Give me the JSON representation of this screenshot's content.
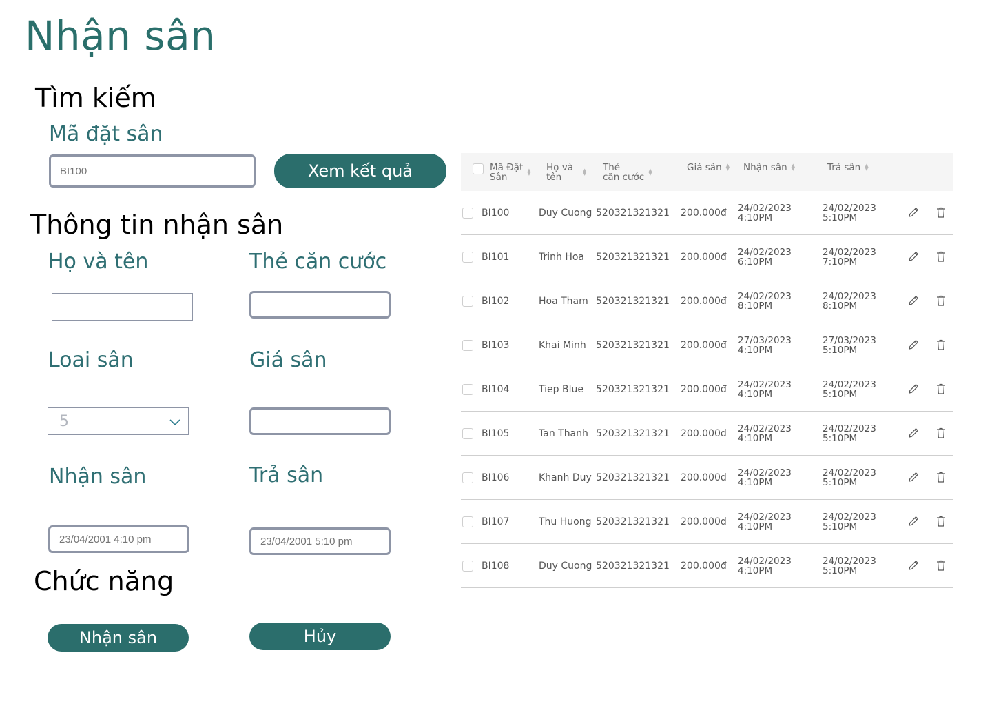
{
  "page": {
    "title": "Nhận sân"
  },
  "search": {
    "heading": "Tìm kiếm",
    "label": "Mã đặt sân",
    "placeholder": "BI100",
    "button": "Xem kết quả"
  },
  "info": {
    "heading": "Thông tin nhận sân",
    "name_label": "Họ và tên",
    "id_label": "Thẻ căn cước",
    "type_label": "Loai sân",
    "type_value": "5",
    "price_label": "Giá sân",
    "checkin_label": "Nhận sân",
    "checkin_placeholder": "23/04/2001 4:10 pm",
    "checkout_label": "Trả sân",
    "checkout_placeholder": "23/04/2001 5:10 pm"
  },
  "functions": {
    "heading": "Chức năng",
    "confirm": "Nhận sân",
    "cancel": "Hủy"
  },
  "table": {
    "headers": {
      "code_1": "Mã Đặt",
      "code_2": "Sân",
      "name_1": "Họ và",
      "name_2": "tên",
      "card_1": "Thẻ",
      "card_2": "căn cước",
      "price": "Giá sân",
      "checkin": "Nhận sân",
      "checkout": "Trả sân"
    },
    "rows": [
      {
        "code": "BI100",
        "name": "Duy Cuong",
        "card": "520321321321",
        "price": "200.000đ",
        "in_date": "24/02/2023",
        "in_time": "4:10PM",
        "out_date": "24/02/2023",
        "out_time": "5:10PM"
      },
      {
        "code": "BI101",
        "name": "Trinh Hoa",
        "card": "520321321321",
        "price": "200.000đ",
        "in_date": "24/02/2023",
        "in_time": "6:10PM",
        "out_date": "24/02/2023",
        "out_time": "7:10PM"
      },
      {
        "code": "BI102",
        "name": "Hoa Tham",
        "card": "520321321321",
        "price": "200.000đ",
        "in_date": "24/02/2023",
        "in_time": "8:10PM",
        "out_date": "24/02/2023",
        "out_time": "8:10PM"
      },
      {
        "code": "BI103",
        "name": "Khai Minh",
        "card": "520321321321",
        "price": "200.000đ",
        "in_date": "27/03/2023",
        "in_time": "4:10PM",
        "out_date": "27/03/2023",
        "out_time": "5:10PM"
      },
      {
        "code": "BI104",
        "name": "Tiep Blue",
        "card": "520321321321",
        "price": "200.000đ",
        "in_date": "24/02/2023",
        "in_time": "4:10PM",
        "out_date": "24/02/2023",
        "out_time": "5:10PM"
      },
      {
        "code": "BI105",
        "name": "Tan Thanh",
        "card": "520321321321",
        "price": "200.000đ",
        "in_date": "24/02/2023",
        "in_time": "4:10PM",
        "out_date": "24/02/2023",
        "out_time": "5:10PM"
      },
      {
        "code": "BI106",
        "name": "Khanh Duy",
        "card": "520321321321",
        "price": "200.000đ",
        "in_date": "24/02/2023",
        "in_time": "4:10PM",
        "out_date": "24/02/2023",
        "out_time": "5:10PM"
      },
      {
        "code": "BI107",
        "name": "Thu Huong",
        "card": "520321321321",
        "price": "200.000đ",
        "in_date": "24/02/2023",
        "in_time": "4:10PM",
        "out_date": "24/02/2023",
        "out_time": "5:10PM"
      },
      {
        "code": "BI108",
        "name": "Duy Cuong",
        "card": "520321321321",
        "price": "200.000đ",
        "in_date": "24/02/2023",
        "in_time": "4:10PM",
        "out_date": "24/02/2023",
        "out_time": "5:10PM"
      }
    ]
  },
  "colors": {
    "accent": "#2b6e6c",
    "label": "#2f6f73",
    "border": "#8e95a6"
  }
}
